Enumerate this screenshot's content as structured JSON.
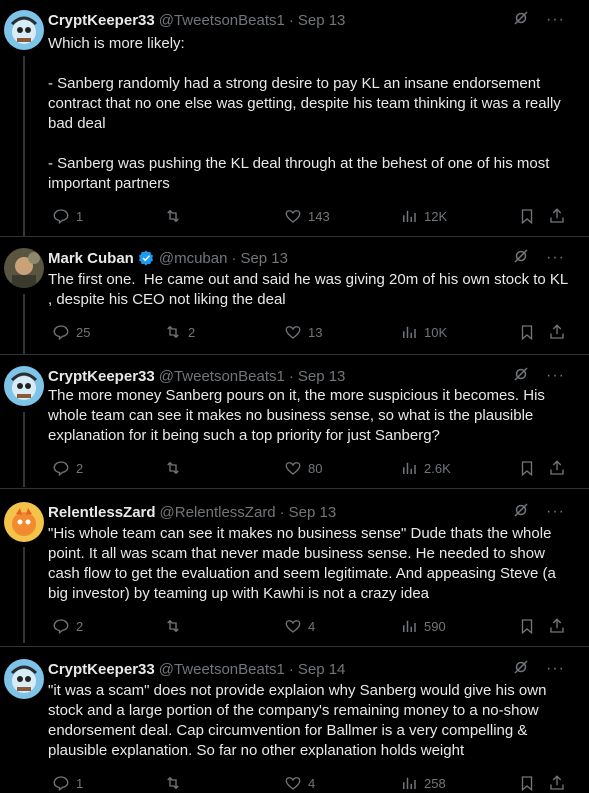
{
  "tweets": [
    {
      "name": "CryptKeeper33",
      "handle": "@TweetsonBeats1",
      "date": "Sep 13",
      "verified": false,
      "text": "Which is more likely:\n\n- Sanberg randomly had a strong desire to pay KL an insane endorsement contract that no one else was getting, despite his team thinking it was a really bad deal\n\n- Sanberg was pushing the KL deal through at the behest of one of his most important partners",
      "replies": "1",
      "reposts": "",
      "likes": "143",
      "views": "12K"
    },
    {
      "name": "Mark Cuban",
      "handle": "@mcuban",
      "date": "Sep 13",
      "verified": true,
      "text": "The first one.  He came out and said he was giving 20m of his own stock to KL , despite his CEO not liking the deal",
      "replies": "25",
      "reposts": "2",
      "likes": "13",
      "views": "10K"
    },
    {
      "name": "CryptKeeper33",
      "handle": "@TweetsonBeats1",
      "date": "Sep 13",
      "verified": false,
      "text": "The more money Sanberg pours on it, the more suspicious it becomes. His whole team can see it makes no business sense, so what is the plausible explanation for it being such a top priority for just Sanberg?",
      "replies": "2",
      "reposts": "",
      "likes": "80",
      "views": "2.6K"
    },
    {
      "name": "RelentlessZard",
      "handle": "@RelentlessZard",
      "date": "Sep 13",
      "verified": false,
      "text": "\"His whole team can see it makes no business sense\" Dude thats the whole point. It all was scam that never made business sense. He needed to show cash flow to get the evaluation and seem legitimate. And appeasing Steve (a big investor) by teaming up with Kawhi is not a crazy idea",
      "replies": "2",
      "reposts": "",
      "likes": "4",
      "views": "590"
    },
    {
      "name": "CryptKeeper33",
      "handle": "@TweetsonBeats1",
      "date": "Sep 14",
      "verified": false,
      "text": "\"it was a scam\" does not provide explaion why Sanberg would give his own stock and a large portion of the company's remaining money to a no-show endorsement deal. Cap circumvention for Ballmer is a very compelling & plausible explanation. So far no other explanation holds weight",
      "replies": "1",
      "reposts": "",
      "likes": "4",
      "views": "258"
    }
  ],
  "colors": {
    "text": "#e7e9ea",
    "muted": "#71767b",
    "verified": "#1d9bf0",
    "bg": "#000000"
  },
  "icons": [
    "reply-icon",
    "repost-icon",
    "like-icon",
    "views-icon",
    "bookmark-icon",
    "share-icon",
    "grok-icon",
    "more-icon",
    "verified-badge-icon"
  ]
}
